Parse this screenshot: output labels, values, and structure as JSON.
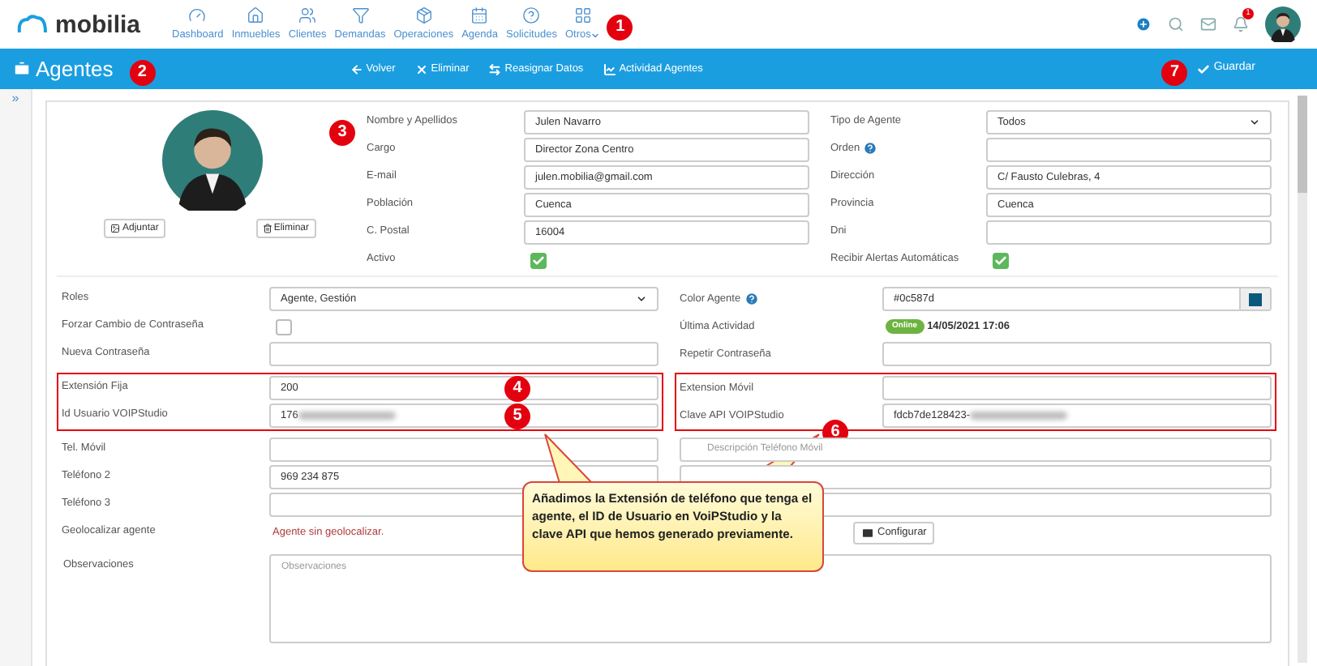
{
  "top_nav": {
    "logo": "mobilia",
    "items": [
      {
        "label": "Dashboard"
      },
      {
        "label": "Inmuebles"
      },
      {
        "label": "Clientes"
      },
      {
        "label": "Demandas"
      },
      {
        "label": "Operaciones"
      },
      {
        "label": "Agenda"
      },
      {
        "label": "Solicitudes"
      },
      {
        "label": "Otros",
        "dropdown": true
      }
    ],
    "marker": "1",
    "notification_count": "1"
  },
  "toolbar": {
    "title": "Agentes",
    "marker": "2",
    "actions": [
      {
        "label": "Volver"
      },
      {
        "label": "Eliminar"
      },
      {
        "label": "Reasignar Datos"
      },
      {
        "label": "Actividad Agentes"
      }
    ],
    "save_marker": "7",
    "save": "Guardar"
  },
  "sidebar": {
    "toggle": "»"
  },
  "profile": {
    "marker": "3",
    "buttons": [
      "Adjuntar",
      "Eliminar"
    ],
    "left": [
      {
        "label": "Nombre y Apellidos",
        "kind": "text",
        "value": "Julen Navarro"
      },
      {
        "label": "Cargo",
        "kind": "text",
        "value": "Director Zona Centro"
      },
      {
        "label": "E-mail",
        "kind": "text",
        "value": "julen.mobilia@gmail.com"
      },
      {
        "label": "Población",
        "kind": "text",
        "value": "Cuenca"
      },
      {
        "label": "C. Postal",
        "kind": "text",
        "value": "16004"
      },
      {
        "label": "Activo",
        "kind": "checkbox",
        "checked": true
      }
    ],
    "right": [
      {
        "label": "Tipo de Agente",
        "kind": "select",
        "value": "Todos"
      },
      {
        "label": "Orden",
        "kind": "text",
        "help": true
      },
      {
        "label": "Dirección",
        "kind": "text",
        "value": "C/ Fausto Culebras, 4"
      },
      {
        "label": "Provincia",
        "kind": "text",
        "value": "Cuenca"
      },
      {
        "label": "Dni",
        "kind": "text"
      },
      {
        "label": "Recibir Alertas Automáticas",
        "kind": "checkbox",
        "checked": true
      }
    ]
  },
  "sections": [
    {
      "highlighted": false,
      "rows": [
        {
          "left": {
            "label": "Roles",
            "kind": "select",
            "value": "Agente, Gestión"
          },
          "right": {
            "label": "Color Agente",
            "kind": "color",
            "help": true,
            "value": "#0c587d",
            "color": "#0c587d"
          }
        },
        {
          "left": {
            "label": "Forzar Cambio de Contraseña",
            "kind": "checkbox",
            "checked": false
          },
          "right": {
            "label": "Última Actividad",
            "kind": "status",
            "status": "Online",
            "value": "14/05/2021 17:06"
          }
        },
        {
          "left": {
            "label": "Nueva Contraseña",
            "kind": "text"
          },
          "right": {
            "label": "Repetir Contraseña",
            "kind": "text"
          }
        }
      ]
    },
    {
      "highlighted": true,
      "rows": [
        {
          "left": {
            "label": "Extensión Fija",
            "kind": "text",
            "value": "200",
            "marker": "4"
          },
          "right": {
            "label": "Extension Móvil",
            "kind": "text"
          }
        },
        {
          "left": {
            "label": "Id Usuario VOIPStudio",
            "kind": "text",
            "value": "176",
            "blurred": true,
            "marker": "5"
          },
          "right": {
            "label": "Clave API VOIPStudio",
            "kind": "text",
            "value": "fdcb7de128423-",
            "blurred": true,
            "label_marker": "6"
          }
        }
      ]
    },
    {
      "highlighted": false,
      "rows": [
        {
          "left": {
            "label": "Tel. Móvil",
            "kind": "text"
          },
          "right": {
            "kind": "wide",
            "placeholder": "Descripción Teléfono Móvil"
          }
        },
        {
          "left": {
            "label": "Teléfono 2",
            "kind": "text",
            "value": "969 234 875"
          },
          "right": {
            "kind": "wide"
          }
        },
        {
          "left": {
            "label": "Teléfono 3",
            "kind": "text"
          },
          "right": {
            "kind": "wide"
          }
        },
        {
          "left": {
            "label": "Geolocalizar agente",
            "kind": "link",
            "value": "Agente sin geolocalizar."
          },
          "right": {
            "kind": "button",
            "value": "Configurar"
          }
        }
      ]
    }
  ],
  "observations": {
    "label": "Observaciones",
    "placeholder": "Observaciones"
  },
  "callout": {
    "text": "Añadimos la  Extensión de teléfono que tenga el agente, el ID de Usuario en VoiPStudio y  la clave API que hemos generado previamente."
  }
}
